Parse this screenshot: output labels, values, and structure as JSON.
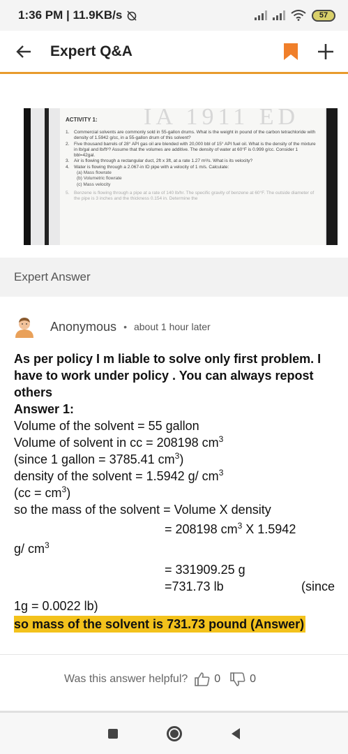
{
  "status_bar": {
    "time_speed": "1:36 PM | 11.9KB/s",
    "battery": "57"
  },
  "app_bar": {
    "title": "Expert Q&A"
  },
  "question_image": {
    "watermark": "IA 1911 ED",
    "heading": "ACTIVITY 1:",
    "items": [
      {
        "num": "1.",
        "text": "Commercial solvents are commonly sold in 55-gallon drums. What is the weight in pound of the carbon tetrachloride with density of 1.5942 g/cc, in a 55-gallon drum of this solvent?"
      },
      {
        "num": "2.",
        "text": "Five thousand barrels of 28° API gas oil are blended with 20,000 bbl of 15° API fuel oil. What is the density of the mixture in lb/gal and lb/ft³? Assume that the volumes are additive. The density of water at 60°F is 0.999 g/cc. Consider 1 bbl=42gal."
      },
      {
        "num": "3.",
        "text": "Air is flowing through a rectangular duct, 2ft x 3ft, at a rate 1.27 m³/s. What is its velocity?"
      },
      {
        "num": "4.",
        "text": "Water is flowing through a 2.067-in ID pipe with a velocity of 1 m/s. Calculate:"
      }
    ],
    "sub_items": [
      "(a) Mass flowrate",
      "(b) Volumetric flowrate",
      "(c) Mass velocity"
    ],
    "faded_item": {
      "num": "5.",
      "text": "Benzene is flowing through a pipe at a rate of 140 lb/hr. The specific gravity of benzene at 60°F. The outside diameter of the pipe is 3 inches and the thickness 0.154 in. Determine the"
    }
  },
  "expert_answer_label": "Expert Answer",
  "author": {
    "name": "Anonymous",
    "time": "about 1 hour later"
  },
  "answer": {
    "policy_text": "As per policy I m liable to solve only first problem. I have to work under policy . You can always repost others",
    "answer_heading": "Answer 1:",
    "line_volume": "Volume of the solvent = 55 gallon",
    "line_volume_cc": "Volume of solvent in cc = 208198 cm",
    "line_since_gallon": " (since 1 gallon = 3785.41 cm",
    "line_since_gallon_end": ")",
    "line_density": "density of the solvent = 1.5942 g/ cm",
    "line_cc": "(cc = cm",
    "line_cc_end": ")",
    "line_mass": "so the mass of the solvent = Volume X density",
    "line_calc": "= 208198 cm",
    "line_calc_mid": " X   1.5942",
    "line_calc_unit": "g/ cm",
    "line_result_g": "= 331909.25 g",
    "line_result_lb": "=731.73 lb",
    "line_since": "(since",
    "line_conversion": "1g = 0.0022 lb)",
    "final_answer": "so mass of the solvent is 731.73 pound   (Answer)",
    "superscript": "3"
  },
  "helpful": {
    "question": "Was this answer helpful?",
    "likes": "0",
    "dislikes": "0"
  },
  "colors": {
    "accent": "#e89b2d",
    "bookmark": "#f07f2a",
    "highlight": "#f3c21c"
  }
}
